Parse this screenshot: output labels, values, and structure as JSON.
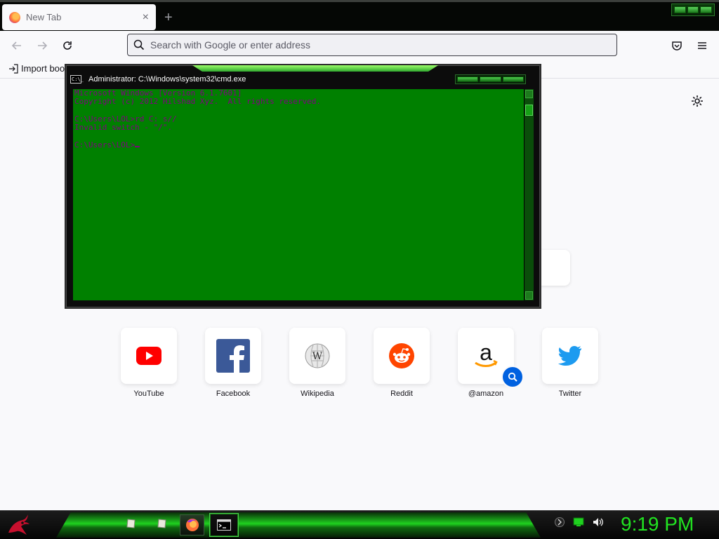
{
  "browser": {
    "tab": {
      "title": "New Tab",
      "close": "×"
    },
    "new_tab_glyph": "+",
    "nav": {
      "back_icon": "arrow-left-icon",
      "forward_icon": "arrow-right-icon",
      "reload_icon": "reload-icon"
    },
    "urlbar": {
      "placeholder": "Search with Google or enter address",
      "value": ""
    },
    "bookmarks_bar": {
      "import_label": "Import boo"
    }
  },
  "newtab": {
    "top_sites": [
      {
        "label": "YouTube",
        "icon": "youtube-icon"
      },
      {
        "label": "Facebook",
        "icon": "facebook-icon"
      },
      {
        "label": "Wikipedia",
        "icon": "wikipedia-icon"
      },
      {
        "label": "Reddit",
        "icon": "reddit-icon"
      },
      {
        "label": "@amazon",
        "icon": "amazon-icon"
      },
      {
        "label": "Twitter",
        "icon": "twitter-icon"
      }
    ]
  },
  "cmd_window": {
    "title": "Administrator: C:\\Windows\\system32\\cmd.exe",
    "icon_text": "C:\\_",
    "lines": [
      "Microsoft Windows [Version 6.1.7601]",
      "Copyright (c) 2012 Hilshad Xyz.  All rights reserved.",
      "",
      "C:\\Users\\LOL>rd C: s//",
      "Invalid switch - \"/\".",
      "",
      "C:\\Users\\LOL>"
    ],
    "colors": {
      "background": "#008000",
      "text": "#800080"
    }
  },
  "taskbar": {
    "clock": "9:19 PM",
    "clock_color": "#21e321",
    "accent": "#1fd11f"
  }
}
